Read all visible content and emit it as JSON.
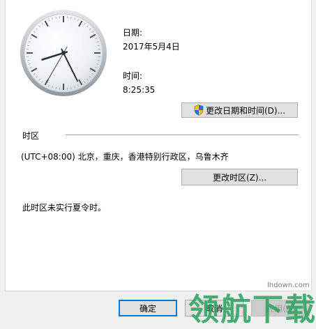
{
  "date": {
    "label": "日期:",
    "value": "2017年5月4日"
  },
  "time": {
    "label": "时间:",
    "value": "8:25:35"
  },
  "buttons": {
    "change_datetime": "更改日期和时间(D)...",
    "change_timezone": "更改时区(Z)...",
    "ok": "确定",
    "cancel": "取消",
    "apply": "应用(A)"
  },
  "timezone": {
    "section_label": "时区",
    "value": "(UTC+08:00) 北京，重庆，香港特别行政区，乌鲁木齐",
    "dst_note": "此时区未实行夏令时。"
  },
  "clock": {
    "hour": 8,
    "minute": 25,
    "second": 35
  },
  "watermark": {
    "text": "领航下载",
    "url": "lhdown.com"
  }
}
